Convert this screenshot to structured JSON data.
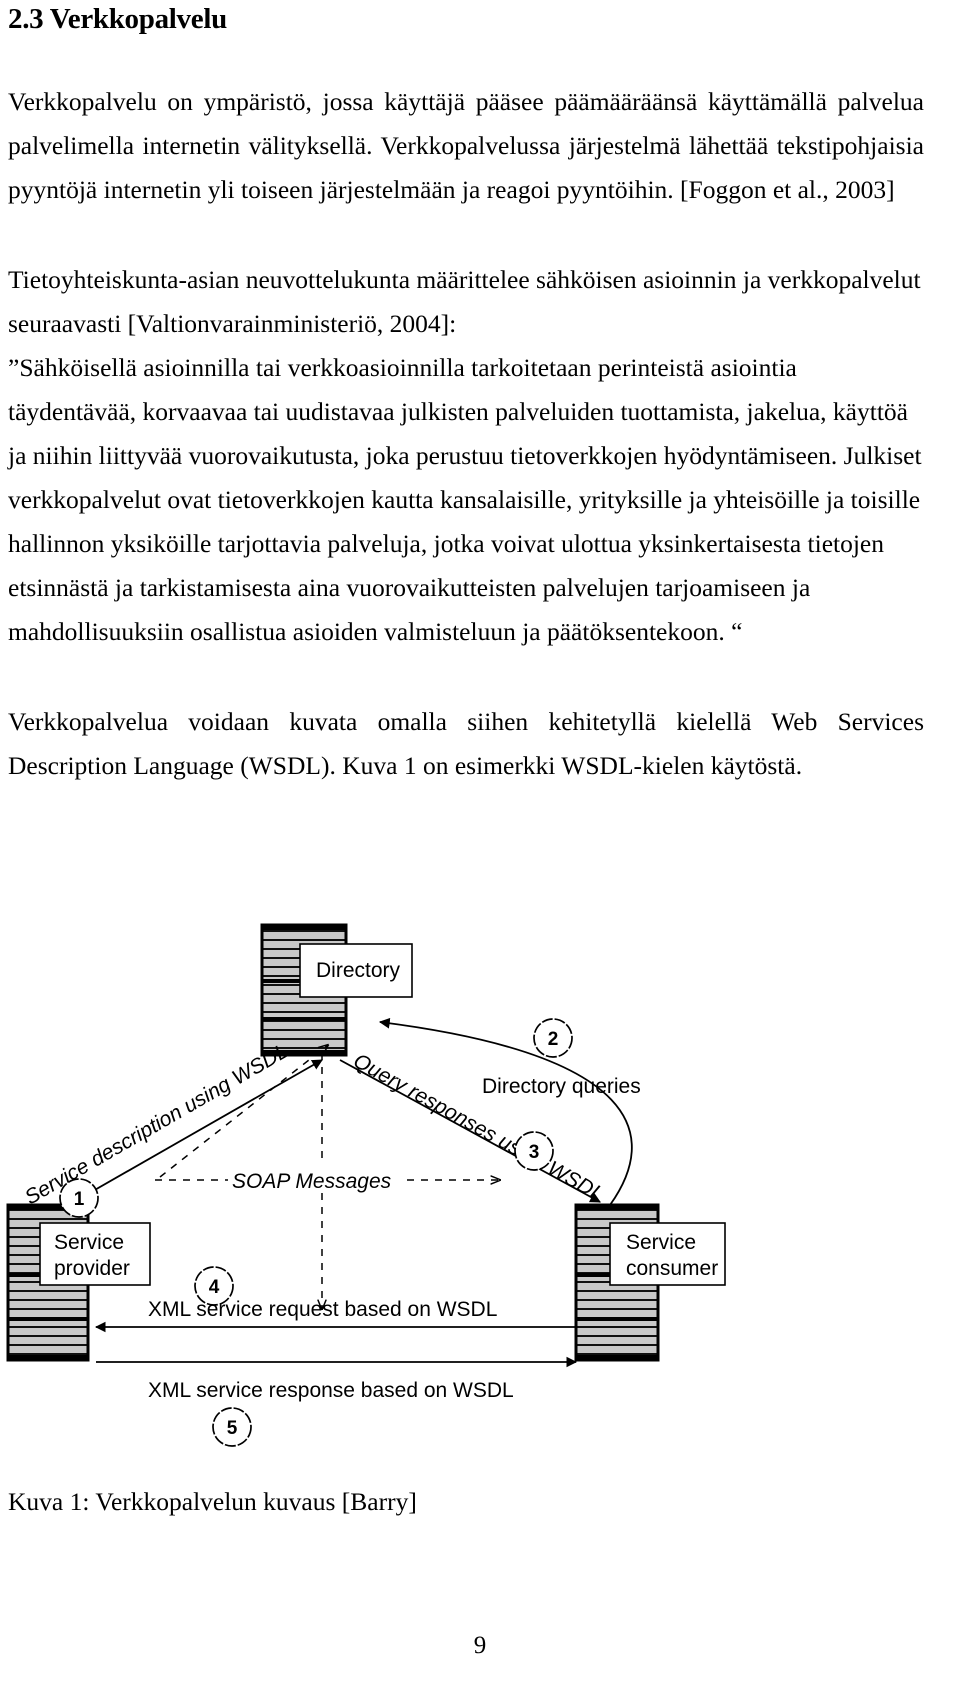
{
  "document": {
    "page_number": "9",
    "heading": "2.3  Verkkopalvelu",
    "paragraphs": {
      "p1": "Verkkopalvelu on ympäristö, jossa käyttäjä pääsee päämääräänsä käyttämällä palvelua palvelimella internetin välityksellä. Verkkopalvelussa järjestelmä lähettää tekstipohjaisia pyyntöjä internetin yli toiseen järjestelmään ja reagoi pyyntöihin. [Foggon et al., 2003]",
      "p2": "Tietoyhteiskunta-asian neuvottelukunta määrittelee sähköisen asioinnin ja verkkopalvelut seuraavasti  [Valtionvarainministeriö, 2004]:",
      "p3": "”Sähköisellä asioinnilla tai verkkoasioinnilla tarkoitetaan perinteistä asiointia täydentävää, korvaavaa tai uudistavaa julkisten palveluiden tuottamista, jakelua, käyttöä ja niihin liittyvää vuorovaikutusta, joka perustuu tietoverkkojen hyödyntämiseen. Julkiset verkkopalvelut ovat tietoverkkojen kautta kansalaisille, yrityksille ja yhteisöille ja toisille hallinnon yksiköille tarjottavia palveluja, jotka voivat ulottua yksinkertaisesta tietojen etsinnästä ja tarkistamisesta aina vuorovaikutteisten palvelujen tarjoamiseen ja mahdollisuuksiin osallistua asioiden valmisteluun ja päätöksentekoon. “",
      "p4": "Verkkopalvelua voidaan kuvata omalla siihen kehitetyllä kielellä  Web Services Description Language (WSDL). Kuva 1 on esimerkki WSDL-kielen käytöstä."
    },
    "figure": {
      "caption": "Kuva 1: Verkkopalvelun kuvaus [Barry]",
      "nodes": {
        "directory": "Directory",
        "service_provider_line1": "Service",
        "service_provider_line2": "provider",
        "service_consumer_line1": "Service",
        "service_consumer_line2": "consumer"
      },
      "edges": {
        "service_description": "Service description using WSDL",
        "directory_queries": "Directory queries",
        "query_responses": "Query responses using WSDL",
        "soap_messages": "SOAP Messages",
        "xml_request": "XML service request based on WSDL",
        "xml_response": "XML service response based on WSDL"
      },
      "step_numbers": {
        "n1": "1",
        "n2": "2",
        "n3": "3",
        "n4": "4",
        "n5": "5"
      }
    }
  }
}
